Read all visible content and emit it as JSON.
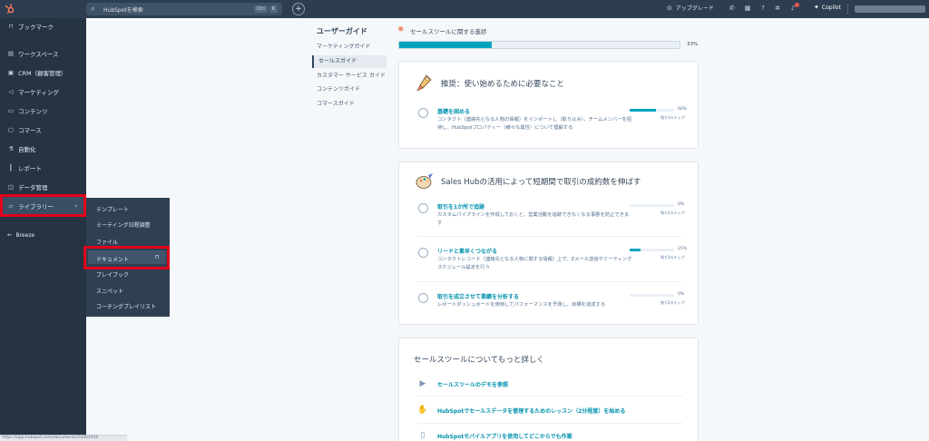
{
  "topbar": {
    "search_placeholder": "HubSpotを検索",
    "shortcut_ctrl": "Ctrl",
    "shortcut_key": "K",
    "add_label": "+",
    "upgrade_label": "アップグレード",
    "copilot_label": "Copilot"
  },
  "sidebar": {
    "items": [
      {
        "icon": "bookmark-icon",
        "label": "ブックマーク"
      },
      {
        "icon": "workspace-icon",
        "label": "ワークスペース"
      },
      {
        "icon": "crm-icon",
        "label": "CRM（顧客管理）"
      },
      {
        "icon": "marketing-icon",
        "label": "マーケティング"
      },
      {
        "icon": "content-icon",
        "label": "コンテンツ"
      },
      {
        "icon": "commerce-icon",
        "label": "コマース"
      },
      {
        "icon": "automation-icon",
        "label": "自動化"
      },
      {
        "icon": "report-icon",
        "label": "レポート"
      },
      {
        "icon": "data-icon",
        "label": "データ管理"
      },
      {
        "icon": "library-icon",
        "label": "ライブラリー"
      }
    ],
    "breeze_label": "Breeze"
  },
  "library_menu": {
    "items": [
      "テンプレート",
      "ミーティング日程調整",
      "ファイル",
      "ドキュメント",
      "プレイブック",
      "スニペット",
      "コーチングプレイリスト"
    ]
  },
  "status_url": "https://app.hubspot.com/documents/24462930",
  "guide": {
    "title": "ユーザーガイド",
    "items": [
      "マーケティングガイド",
      "セールスガイド",
      "カスタマー サービス ガイド",
      "コンテンツガイド",
      "コマースガイド"
    ]
  },
  "progress": {
    "title": "セールスツールに関する進捗",
    "percent": 33,
    "percent_label": "33%"
  },
  "cards": {
    "recommended": {
      "title": "推奨：使い始めるために必要なこと",
      "tasks": [
        {
          "title": "基礎を固める",
          "desc": "コンタクト（連絡先となる人物の情報）をインポートし（取り込み）、チームメンバーを招待し、HubSpotプロパティー（様々な属性）について理解する",
          "percent": 60,
          "percent_label": "60%",
          "caption": "残り3ステップ"
        }
      ]
    },
    "sales_hub": {
      "title": "Sales Hubの活用によって短期間で取引の成約数を伸ばす",
      "tasks": [
        {
          "title": "取引を1か所で追跡",
          "desc": "カスタムパイプラインを作成しておくと、営業活動を追跡できなくなる事態を防止できます",
          "percent": 0,
          "percent_label": "0%",
          "caption": "残り2ステップ"
        },
        {
          "title": "リードと素早くつながる",
          "desc": "コンタクトレコード（連絡先となる人物に関する情報）上で、Eメール送信やミーティングスケジュール設定を行う",
          "percent": 25,
          "percent_label": "25%",
          "caption": "残り3ステップ"
        },
        {
          "title": "取引を成立させて業績を分析する",
          "desc": "レポートダッシュボードを使用してパフォーマンスを予測し、目標を達成する",
          "percent": 0,
          "percent_label": "0%",
          "caption": "残り2ステップ"
        }
      ]
    },
    "learn_more": {
      "title": "セールスツールについてもっと詳しく",
      "links": [
        {
          "icon": "video-icon",
          "label": "セールスツールのデモを参照"
        },
        {
          "icon": "handshake-icon",
          "label": "HubSpotでセールスデータを管理するためのレッスン（2分程度）を始める"
        },
        {
          "icon": "mobile-icon",
          "label": "HubSpotモバイルアプリを使用してどこからでも作業"
        }
      ]
    }
  },
  "colors": {
    "topbar": "#2d3e50",
    "sidebar": "#253342",
    "accent": "#00a4bd",
    "link": "#0091ae",
    "highlight": "#e3001b"
  }
}
